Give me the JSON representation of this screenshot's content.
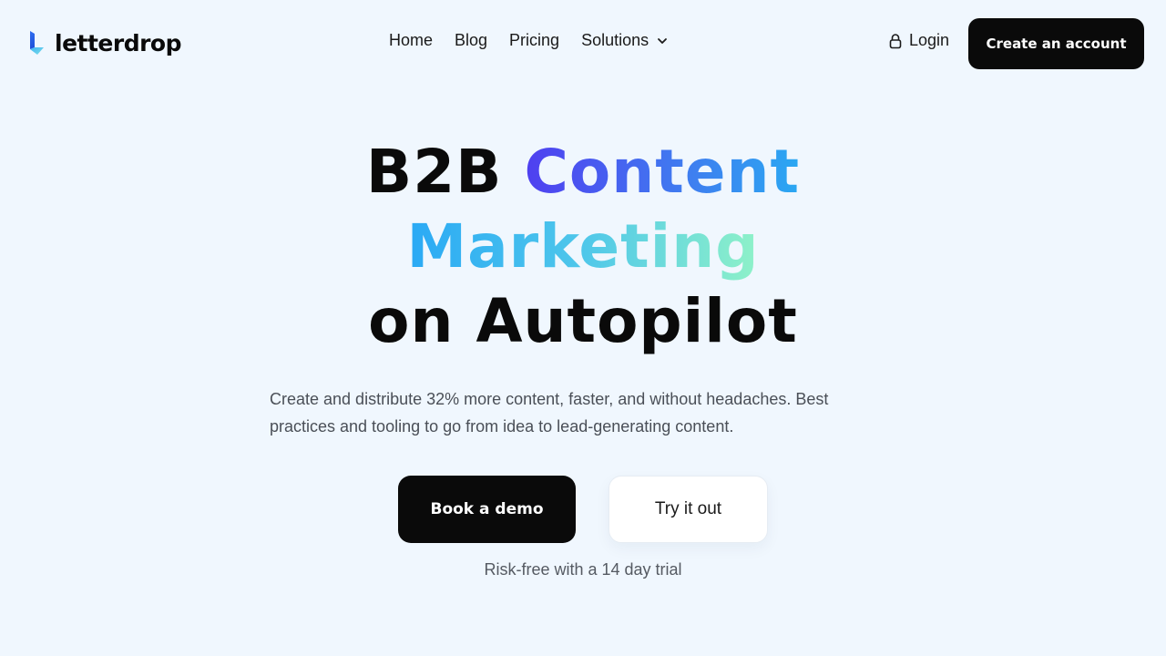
{
  "brand": {
    "name": "letterdrop",
    "logo_icon": "letterdrop-logo-icon"
  },
  "nav": {
    "links": [
      {
        "label": "Home"
      },
      {
        "label": "Blog"
      },
      {
        "label": "Pricing"
      },
      {
        "label": "Solutions",
        "icon": "chevron-down-icon"
      }
    ],
    "login_label": "Login",
    "login_icon": "lock-icon",
    "create_account_label": "Create an account"
  },
  "hero": {
    "title_part1": "B2B ",
    "title_highlight1": "Content",
    "title_highlight2": "Marketing",
    "title_part3": "on Autopilot",
    "subtitle": "Create and distribute 32% more content, faster, and without headaches. Best practices and tooling to go from idea to lead-generating content.",
    "primary_cta": "Book a demo",
    "secondary_cta": "Try it out",
    "note": "Risk-free with a 14 day trial"
  },
  "colors": {
    "background": "#f0f7fe",
    "primary_button": "#0a0a0a",
    "gradient_start": "#4f3ff0",
    "gradient_mid": "#2aa9f5",
    "gradient_end": "#8ff2c8"
  }
}
